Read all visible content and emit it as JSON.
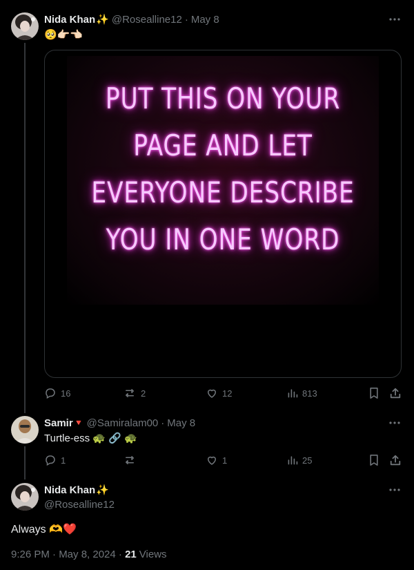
{
  "tweet1": {
    "name": "Nida Khan",
    "badge_emoji": "✨",
    "handle": "@Rosealline12",
    "date": "May 8",
    "separator": "·",
    "text": "🥺👉🏻👈🏻",
    "media_lines": [
      "PUT THIS ON YOUR",
      "PAGE AND LET",
      "EVERYONE DESCRIBE",
      "YOU IN ONE WORD"
    ],
    "replies": "16",
    "reposts": "2",
    "likes": "12",
    "views": "813"
  },
  "tweet2": {
    "name": "Samir",
    "badge_emoji": "🔻",
    "handle": "@Samiralam00",
    "date": "May 8",
    "separator": "·",
    "text": "Turtle-ess 🐢 🔗 🐢",
    "replies": "1",
    "reposts": "",
    "likes": "1",
    "views": "25"
  },
  "tweet3": {
    "name": "Nida Khan",
    "badge_emoji": "✨",
    "handle": "@Rosealline12",
    "text": "Always 🫶❤️",
    "timestamp": "9:26 PM · May 8, 2024",
    "views_separator": " · ",
    "views_count": "21",
    "views_label": "Views"
  },
  "colors": {
    "background": "#000000",
    "text_primary": "#e7e9ea",
    "text_secondary": "#71767b",
    "border": "#2f3336",
    "neon": "#f7c8ff"
  },
  "icons": [
    "more-icon",
    "reply-icon",
    "repost-icon",
    "like-icon",
    "views-icon",
    "bookmark-icon",
    "share-icon"
  ]
}
